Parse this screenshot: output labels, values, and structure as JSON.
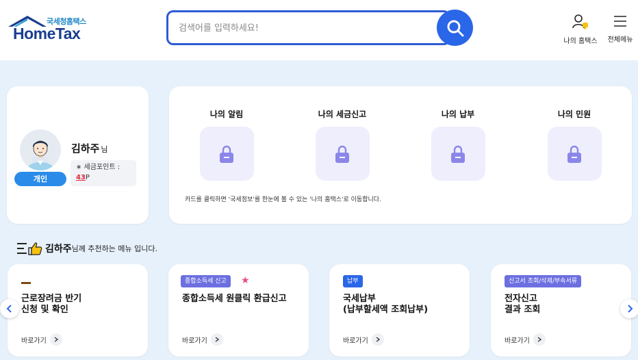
{
  "header": {
    "logo_sub": "국세청홈택스",
    "logo_main": "HomeTax",
    "search_placeholder": "검색어를 입력하세요!",
    "my_hometax_label": "나의 홈택스",
    "all_menu_label": "전체메뉴"
  },
  "profile": {
    "user_type": "개인",
    "name": "김하주",
    "name_suffix": "님",
    "points_label": "∗ 세금포인트 :",
    "points_value": "43",
    "points_unit": "P"
  },
  "my_cards": {
    "items": [
      {
        "title": "나의 알림"
      },
      {
        "title": "나의 세금신고"
      },
      {
        "title": "나의 납부"
      },
      {
        "title": "나의 민원"
      }
    ],
    "note": "카드를 클릭하면 '국세정보'를 한눈에 볼 수 있는 '나의 홈택스'로 이동합니다."
  },
  "recommend": {
    "name": "김하주",
    "title_rest": "님께 추천하는 메뉴 입니다.",
    "go_label": "바로가기",
    "cards": [
      {
        "tag": "",
        "text": "근로장려금 반기\n신청 및 확인"
      },
      {
        "tag": "종합소득세 신고",
        "text": "종합소득세 원클릭 환급신고"
      },
      {
        "tag": "납부",
        "text": "국세납부\n(납부할세액 조회납부)"
      },
      {
        "tag": "신고서 조회/삭제/부속서류",
        "text": "전자신고\n결과 조회"
      }
    ]
  },
  "colors": {
    "brand_blue": "#2a66e8",
    "background": "#e7f1fb",
    "tag_purple": "#6c6fe0",
    "star_pink": "#ec4a78",
    "points_red": "#e0263d"
  },
  "icons": [
    "house-roof-icon",
    "search-icon",
    "user-bell-icon",
    "hamburger-menu-icon",
    "lock-icon",
    "thumbs-up-list-icon",
    "star-icon",
    "chevron-right-icon",
    "chevron-left-icon"
  ]
}
